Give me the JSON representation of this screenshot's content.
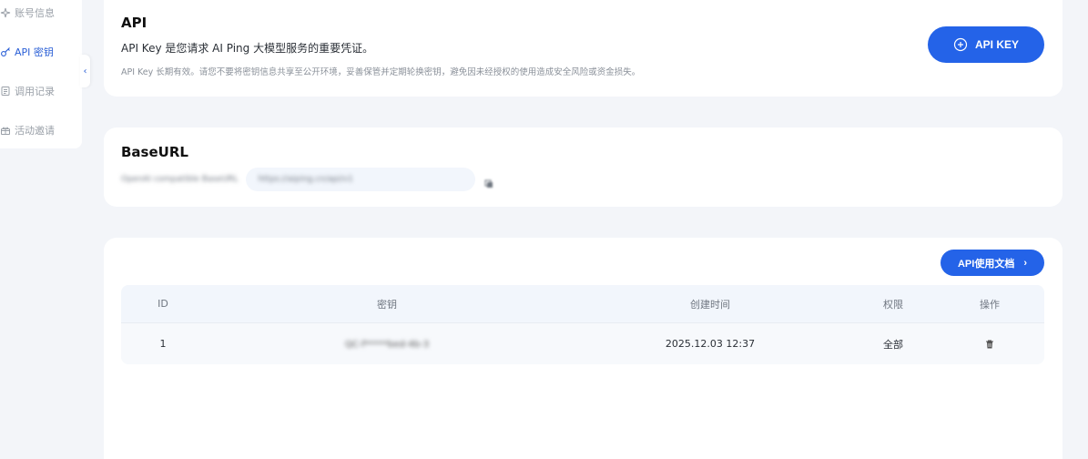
{
  "sidebar": {
    "items": [
      {
        "label": "账号信息",
        "icon": "sparkle-icon",
        "active": false
      },
      {
        "label": "API 密钥",
        "icon": "key-icon",
        "active": true
      },
      {
        "label": "调用记录",
        "icon": "document-icon",
        "active": false
      },
      {
        "label": "活动邀请",
        "icon": "gift-icon",
        "active": false
      }
    ],
    "collapse_glyph": "‹"
  },
  "api_section": {
    "title": "API",
    "description": "API Key 是您请求 AI Ping 大模型服务的重要凭证。",
    "note": "API Key 长期有效。请您不要将密钥信息共享至公开环境，妥善保管并定期轮换密钥，避免因未经授权的使用造成安全风险或资金损失。",
    "create_button": "API KEY"
  },
  "baseurl_section": {
    "title": "BaseURL",
    "label_blurred": "OpenAI compatible BaseURL",
    "url_blurred": "https://aiping.cn/api/v1"
  },
  "keys_table": {
    "doc_button": "API使用文档",
    "doc_chevron": "›",
    "columns": {
      "id": "ID",
      "key": "密钥",
      "created": "创建时间",
      "permission": "权限",
      "action": "操作"
    },
    "rows": [
      {
        "id": "1",
        "key_blurred": "QC-f*****bed-4b-3",
        "created": "2025.12.03 12:37",
        "permission": "全部"
      }
    ]
  },
  "colors": {
    "accent": "#2463e8",
    "background": "#f3f5f9",
    "table_header": "#f2f6fc"
  }
}
